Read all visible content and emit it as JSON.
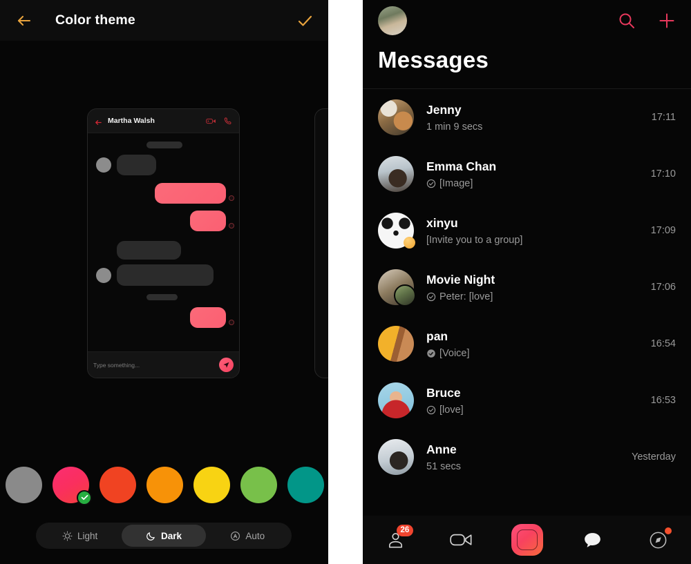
{
  "left_panel": {
    "header": {
      "back_icon": "back-arrow-icon",
      "title": "Color theme",
      "confirm_icon": "checkmark-icon",
      "accent": "#e8a33d"
    },
    "preview": {
      "back_icon": "back-arrow-icon",
      "contact_name": "Martha Walsh",
      "video_call_icon": "video-camera-icon",
      "voice_call_icon": "phone-icon",
      "input_placeholder": "Type something...",
      "send_icon": "send-icon",
      "bubble_accent": "#fb5f72"
    },
    "swatches": [
      {
        "name": "grey",
        "color": "#8a8a8a",
        "selected": false
      },
      {
        "name": "pink",
        "color": "#f9335f",
        "selected": true
      },
      {
        "name": "red-orange",
        "color": "#f04322",
        "selected": false
      },
      {
        "name": "orange",
        "color": "#f79208",
        "selected": false
      },
      {
        "name": "yellow",
        "color": "#f8d313",
        "selected": false
      },
      {
        "name": "green",
        "color": "#78c04a",
        "selected": false
      },
      {
        "name": "teal",
        "color": "#029688",
        "selected": false
      }
    ],
    "selected_badge_icon": "check-circle-icon",
    "modes": [
      {
        "label": "Light",
        "icon": "sun-icon",
        "active": false
      },
      {
        "label": "Dark",
        "icon": "moon-icon",
        "active": true
      },
      {
        "label": "Auto",
        "icon": "auto-circle-a-icon",
        "active": false
      }
    ]
  },
  "right_panel": {
    "topbar": {
      "avatar_icon": "profile-avatar",
      "search_icon": "search-icon",
      "add_icon": "plus-icon",
      "accent": "#e8385c"
    },
    "title": "Messages",
    "conversations": [
      {
        "name": "Jenny",
        "preview": "1 min 9 secs",
        "time": "17:11",
        "status_icon": "none",
        "avatar_badge": false
      },
      {
        "name": "Emma Chan",
        "preview": "[Image]",
        "time": "17:10",
        "status_icon": "check-circle-outline-icon",
        "avatar_badge": false
      },
      {
        "name": "xinyu",
        "preview": "[Invite you to a group]",
        "time": "17:09",
        "status_icon": "none",
        "avatar_badge": true
      },
      {
        "name": "Movie Night",
        "preview": "Peter: [love]",
        "time": "17:06",
        "status_icon": "check-circle-outline-icon",
        "avatar_badge": false
      },
      {
        "name": "pan",
        "preview": "[Voice]",
        "time": "16:54",
        "status_icon": "check-circle-filled-icon",
        "avatar_badge": false
      },
      {
        "name": "Bruce",
        "preview": "[love]",
        "time": "16:53",
        "status_icon": "check-circle-outline-icon",
        "avatar_badge": false
      },
      {
        "name": "Anne",
        "preview": "51 secs",
        "time": "Yesterday",
        "status_icon": "none",
        "avatar_badge": false
      }
    ],
    "nav": [
      {
        "name": "contacts",
        "icon": "contacts-icon",
        "badge": "26",
        "active": false,
        "dot": false
      },
      {
        "name": "video",
        "icon": "video-camera-icon",
        "badge": "",
        "active": false,
        "dot": false
      },
      {
        "name": "capture",
        "icon": "capture-button-icon",
        "badge": "",
        "active": false,
        "dot": false
      },
      {
        "name": "chats",
        "icon": "chat-bubble-icon",
        "badge": "",
        "active": true,
        "dot": false
      },
      {
        "name": "discover",
        "icon": "compass-icon",
        "badge": "",
        "active": false,
        "dot": true
      }
    ]
  }
}
